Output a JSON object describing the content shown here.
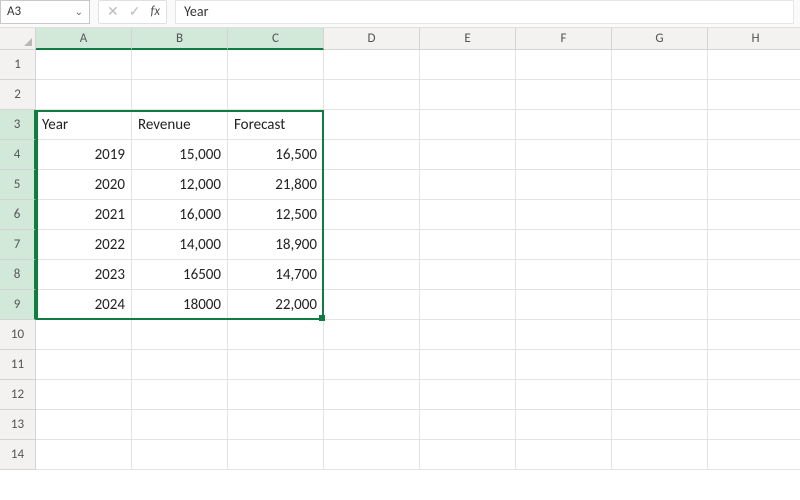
{
  "namebox": {
    "value": "A3"
  },
  "formula_bar": {
    "value": "Year"
  },
  "fx_label": "fx",
  "columns": [
    "A",
    "B",
    "C",
    "D",
    "E",
    "F",
    "G",
    "H"
  ],
  "selected_cols": [
    "A",
    "B",
    "C"
  ],
  "rows": [
    "1",
    "2",
    "3",
    "4",
    "5",
    "6",
    "7",
    "8",
    "9",
    "10",
    "11",
    "12",
    "13",
    "14"
  ],
  "selected_rows": [
    "3",
    "4",
    "5",
    "6",
    "7",
    "8",
    "9"
  ],
  "cells": {
    "A3": {
      "v": "Year",
      "t": "text"
    },
    "B3": {
      "v": "Revenue",
      "t": "text"
    },
    "C3": {
      "v": "Forecast",
      "t": "text"
    },
    "A4": {
      "v": "2019"
    },
    "B4": {
      "v": "15,000"
    },
    "C4": {
      "v": "16,500"
    },
    "A5": {
      "v": "2020"
    },
    "B5": {
      "v": "12,000"
    },
    "C5": {
      "v": "21,800"
    },
    "A6": {
      "v": "2021"
    },
    "B6": {
      "v": "16,000"
    },
    "C6": {
      "v": "12,500"
    },
    "A7": {
      "v": "2022"
    },
    "B7": {
      "v": "14,000"
    },
    "C7": {
      "v": "18,900"
    },
    "A8": {
      "v": "2023"
    },
    "B8": {
      "v": "16500"
    },
    "C8": {
      "v": "14,700"
    },
    "A9": {
      "v": "2024"
    },
    "B9": {
      "v": "18000"
    },
    "C9": {
      "v": "22,000"
    }
  },
  "selection": {
    "top_row": 3,
    "left_col": 1,
    "rows": 7,
    "cols": 3
  }
}
